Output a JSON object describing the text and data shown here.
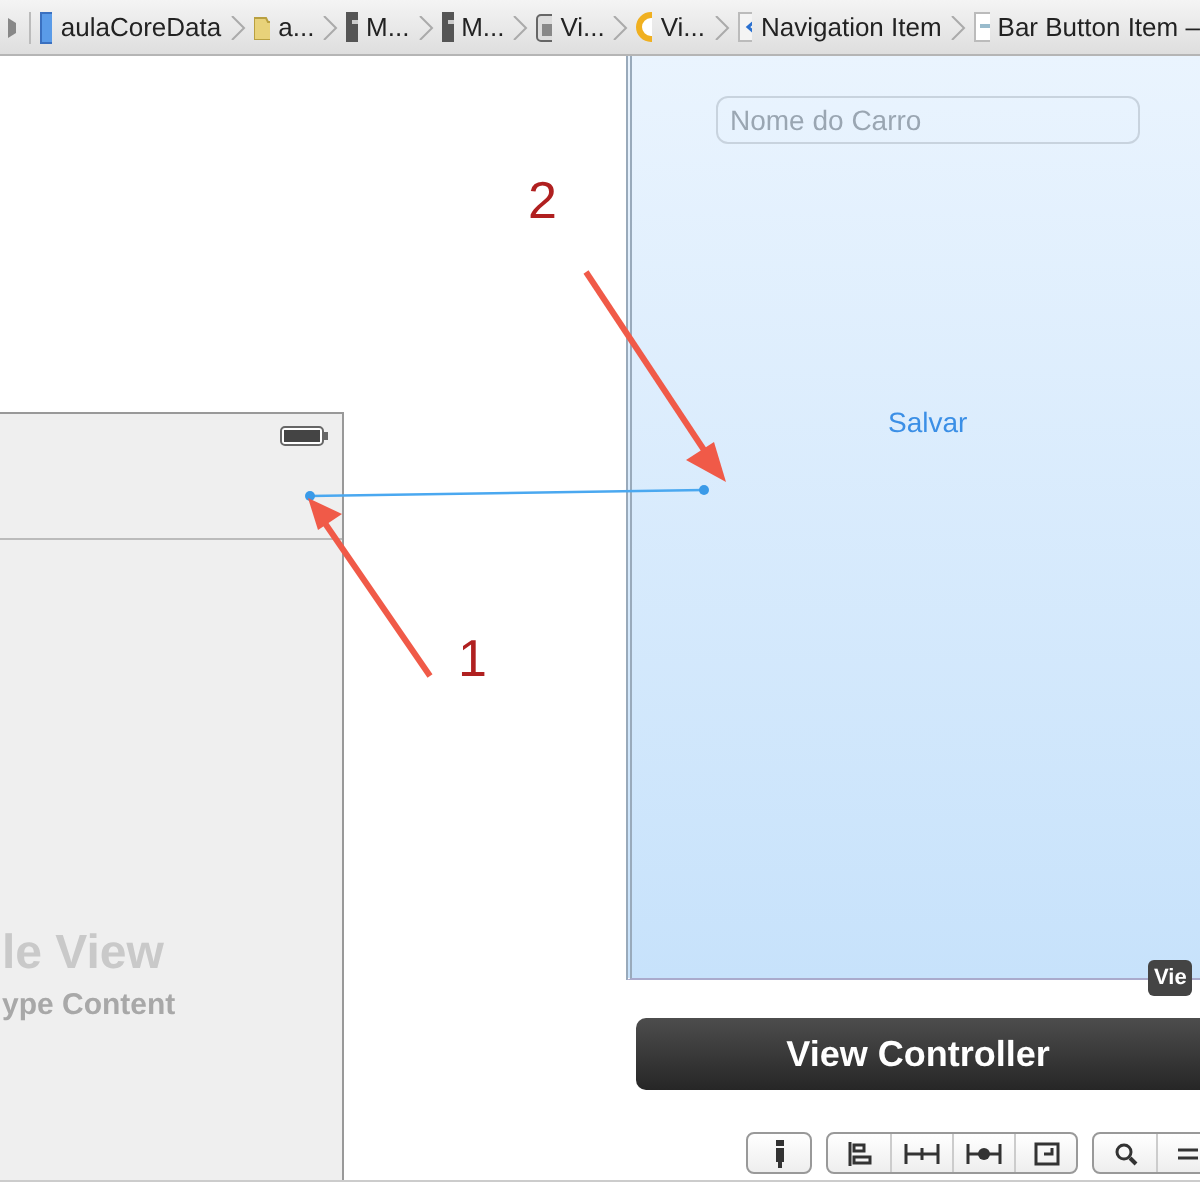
{
  "breadcrumb": {
    "items": [
      {
        "label": "aulaCoreData",
        "kind": "project"
      },
      {
        "label": "a...",
        "kind": "folder"
      },
      {
        "label": "M...",
        "kind": "file"
      },
      {
        "label": "M...",
        "kind": "file"
      },
      {
        "label": "Vi...",
        "kind": "scene"
      },
      {
        "label": "Vi...",
        "kind": "controller"
      },
      {
        "label": "Navigation Item",
        "kind": "navitem"
      },
      {
        "label": "Bar Button Item –",
        "kind": "barbutton"
      }
    ]
  },
  "left_scene": {
    "title": "le View",
    "subtitle": "ype Content"
  },
  "right_scene": {
    "text_field": {
      "placeholder": "Nome do Carro"
    },
    "button": "Salvar",
    "tooltip": "Vie",
    "scene_label": "View Controller"
  },
  "annotations": [
    {
      "label": "1"
    },
    {
      "label": "2"
    }
  ],
  "toolbar": {
    "groups": [
      {
        "buttons": [
          {
            "kind": "pin"
          }
        ]
      },
      {
        "buttons": [
          {
            "kind": "align"
          },
          {
            "kind": "hspace"
          },
          {
            "kind": "hcenter"
          },
          {
            "kind": "frame"
          }
        ]
      },
      {
        "buttons": [
          {
            "kind": "zoom"
          },
          {
            "kind": "menu"
          }
        ]
      }
    ]
  }
}
